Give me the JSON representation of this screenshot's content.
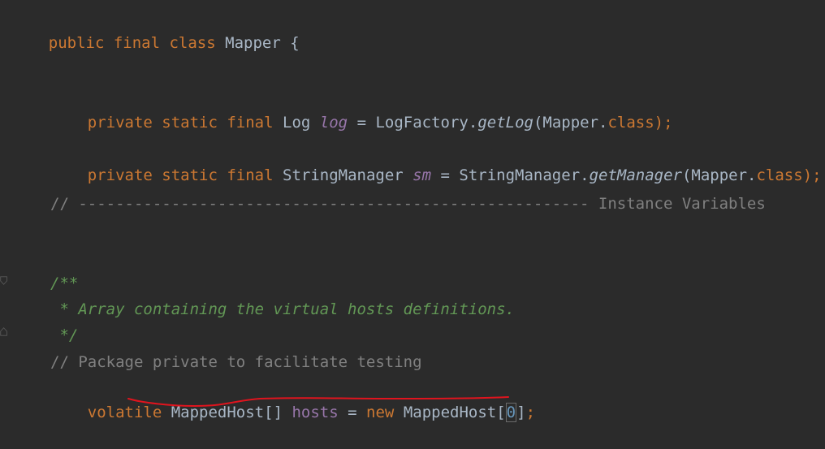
{
  "code": {
    "class_decl": {
      "kw": "public final class",
      "name": "Mapper",
      "brace": "{"
    },
    "log_line": {
      "kw": "private static final",
      "type": "Log",
      "field": "log",
      "eq": "=",
      "factory": "LogFactory.",
      "method": "getLog",
      "open": "(Mapper.",
      "classkw": "class",
      "close": ");"
    },
    "sm_line": {
      "kw": "private static final",
      "type": "StringManager",
      "field": "sm",
      "eq": "=",
      "factory": "StringManager.",
      "method": "getManager",
      "open": "(Mapper.",
      "classkw": "class",
      "close": ");"
    },
    "section_comment": "// ------------------------------------------------------- Instance Variables",
    "doc_open": "/**",
    "doc_body": " * Array containing the virtual hosts definitions.",
    "doc_close": " */",
    "line_comment": "// Package private to facilitate testing",
    "hosts_line": {
      "kw": "volatile",
      "type": "MappedHost[]",
      "field": "hosts",
      "eq": "=",
      "newkw": "new",
      "ctor": "MappedHost[",
      "index": "0",
      "close_bracket": "]",
      "semi": ";"
    }
  },
  "colors": {
    "background": "#2b2b2b",
    "keyword": "#cc7832",
    "text": "#a9b7c6",
    "field": "#9876aa",
    "comment": "#808080",
    "doc_comment": "#629755",
    "number": "#6897bb",
    "annotation_underline": "#e0141e"
  }
}
